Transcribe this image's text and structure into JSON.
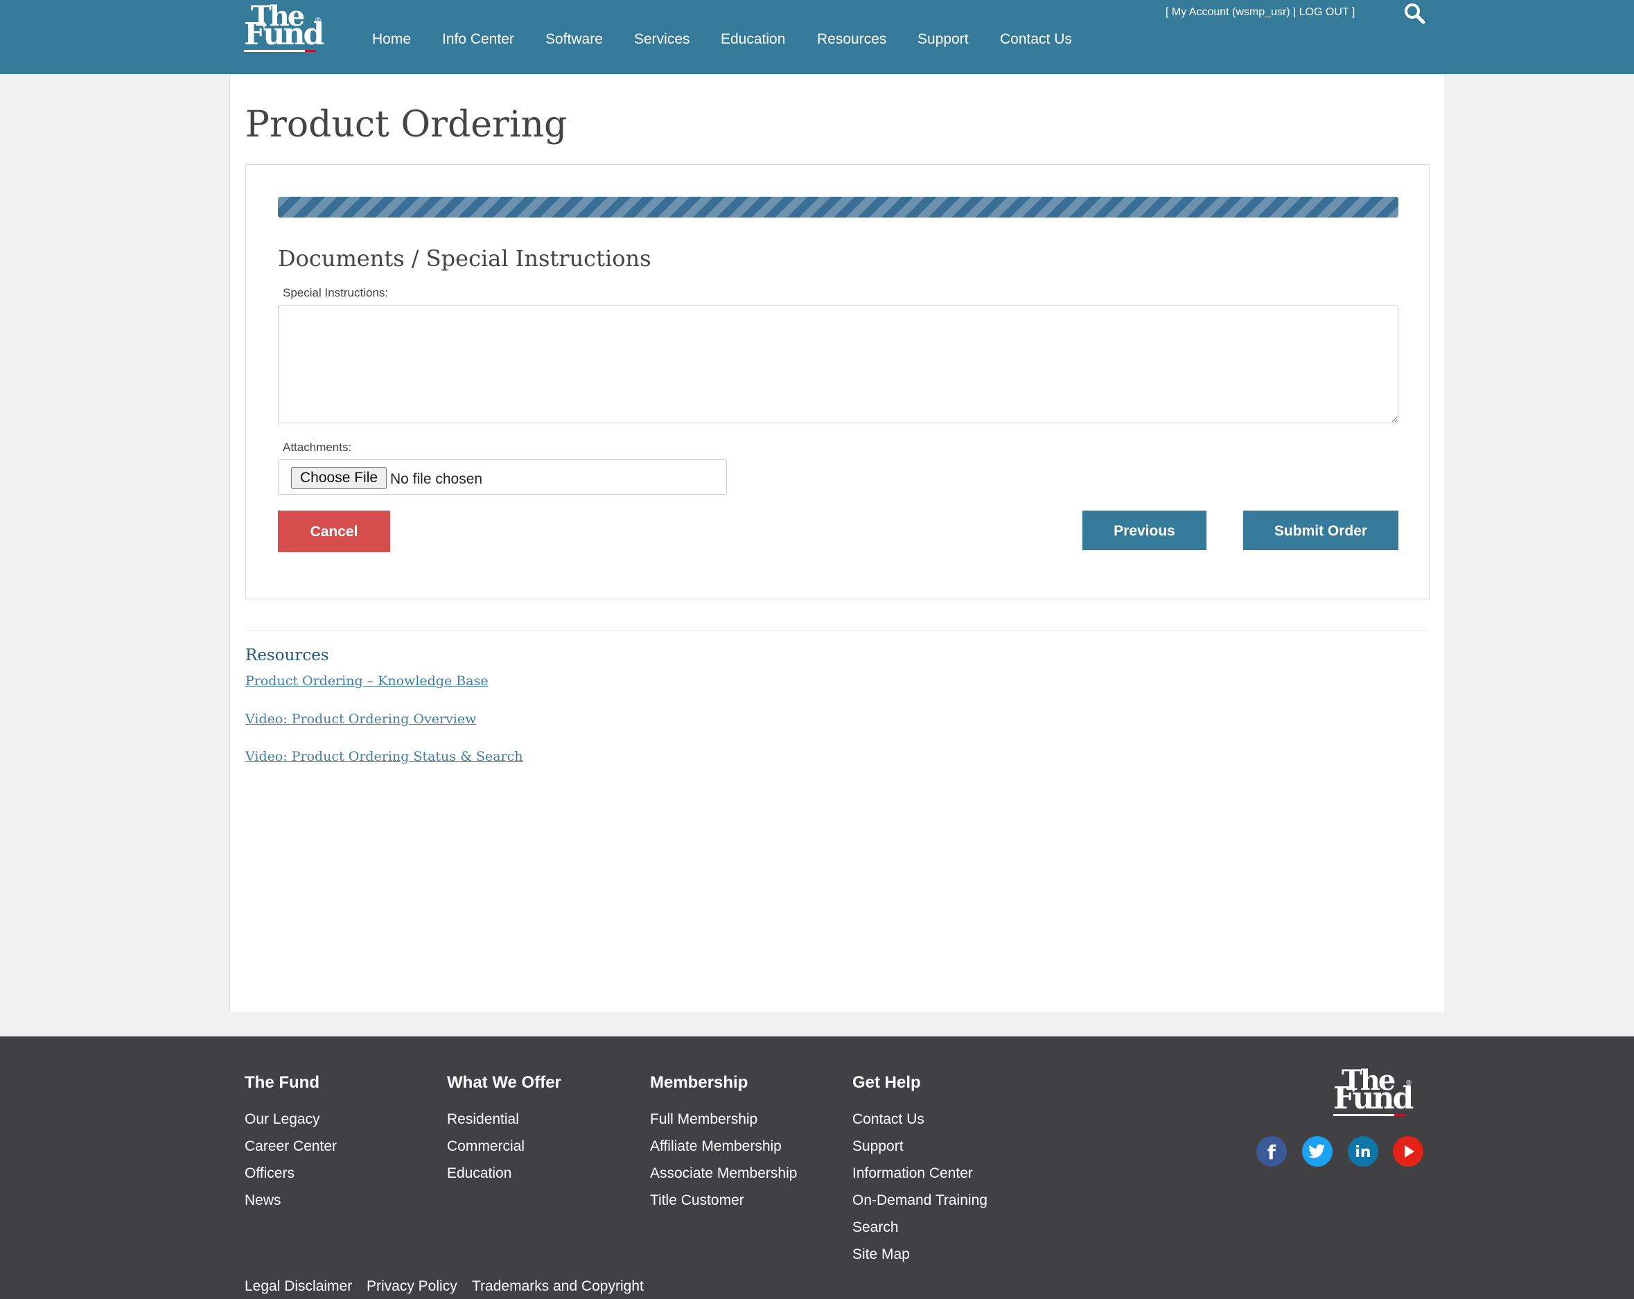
{
  "header": {
    "logo_line1": "The",
    "logo_line2": "Fund",
    "logo_reg": "®",
    "nav": [
      "Home",
      "Info Center",
      "Software",
      "Services",
      "Education",
      "Resources",
      "Support",
      "Contact Us"
    ],
    "account_open": "[ ",
    "account_label": "My Account (wsmp_usr)",
    "account_sep": " | ",
    "logout_label": "LOG OUT",
    "account_close": " ]",
    "search_icon": "magnifier"
  },
  "page": {
    "title": "Product Ordering",
    "progress_percent": 100,
    "section_title": "Documents / Special Instructions",
    "special_instructions_label": "Special Instructions:",
    "special_instructions_value": "",
    "attachments_label": "Attachments:",
    "choose_file_label": "Choose File",
    "file_status": "No file chosen",
    "cancel_label": "Cancel",
    "previous_label": "Previous",
    "submit_label": "Submit Order"
  },
  "resources": {
    "title": "Resources",
    "links": [
      "Product Ordering – Knowledge Base",
      "Video: Product Ordering Overview",
      "Video: Product Ordering Status & Search"
    ]
  },
  "footer": {
    "columns": [
      {
        "title": "The Fund",
        "links": [
          "Our Legacy",
          "Career Center",
          "Officers",
          "News"
        ]
      },
      {
        "title": "What We Offer",
        "links": [
          "Residential",
          "Commercial",
          "Education"
        ]
      },
      {
        "title": "Membership",
        "links": [
          "Full Membership",
          "Affiliate Membership",
          "Associate Membership",
          "Title Customer"
        ]
      },
      {
        "title": "Get Help",
        "links": [
          "Contact Us",
          "Support",
          "Information Center",
          "On-Demand Training",
          "Search",
          "Site Map"
        ]
      }
    ],
    "bottom_links": [
      "Legal Disclaimer",
      "Privacy Policy",
      "Trademarks and Copyright"
    ],
    "logo_line1": "The",
    "logo_line2": "Fund",
    "logo_reg": "®",
    "social": [
      {
        "name": "facebook-icon",
        "glyph": "f"
      },
      {
        "name": "twitter-icon",
        "glyph": ""
      },
      {
        "name": "linkedin-icon",
        "glyph": "in"
      },
      {
        "name": "youtube-icon",
        "glyph": ""
      }
    ]
  },
  "colors": {
    "header_bg": "#367a99",
    "cancel": "#d64d4d",
    "primary_button": "#367a99",
    "progress": "#3b6e95",
    "footer_bg": "#414143",
    "link": "#3f7fa3",
    "facebook": "#3b5998",
    "twitter": "#1da1f2",
    "linkedin": "#0e76a8",
    "youtube": "#e62117"
  }
}
